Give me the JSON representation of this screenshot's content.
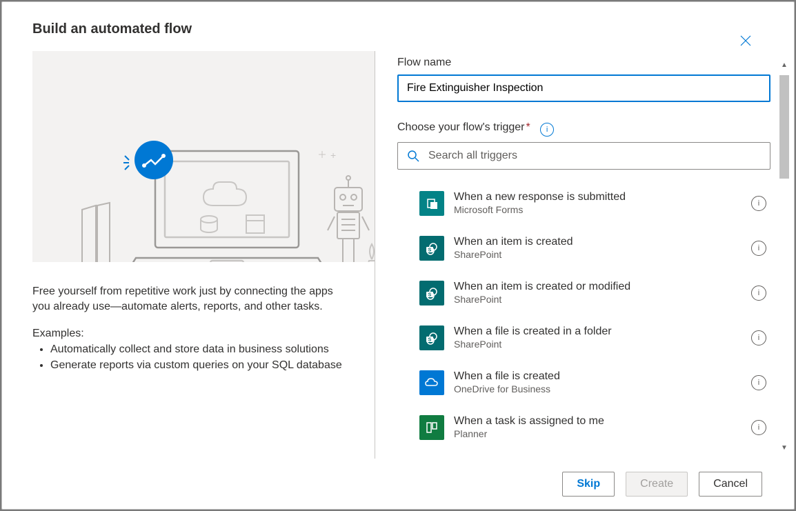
{
  "dialog": {
    "title": "Build an automated flow"
  },
  "hero": {
    "description": "Free yourself from repetitive work just by connecting the apps you already use—automate alerts, reports, and other tasks.",
    "examples_heading": "Examples:",
    "examples": [
      "Automatically collect and store data in business solutions",
      "Generate reports via custom queries on your SQL database"
    ]
  },
  "form": {
    "flow_name_label": "Flow name",
    "flow_name_value": "Fire Extinguisher Inspection",
    "trigger_label": "Choose your flow's trigger",
    "search_placeholder": "Search all triggers"
  },
  "triggers": [
    {
      "title": "When a new response is submitted",
      "connector": "Microsoft Forms",
      "icon": "forms"
    },
    {
      "title": "When an item is created",
      "connector": "SharePoint",
      "icon": "sp"
    },
    {
      "title": "When an item is created or modified",
      "connector": "SharePoint",
      "icon": "sp"
    },
    {
      "title": "When a file is created in a folder",
      "connector": "SharePoint",
      "icon": "sp"
    },
    {
      "title": "When a file is created",
      "connector": "OneDrive for Business",
      "icon": "onedrive"
    },
    {
      "title": "When a task is assigned to me",
      "connector": "Planner",
      "icon": "planner"
    }
  ],
  "buttons": {
    "skip": "Skip",
    "create": "Create",
    "cancel": "Cancel"
  },
  "icons": {
    "forms_glyph": "F",
    "sp_glyph": "s",
    "onedrive_glyph": "cloud",
    "planner_glyph": "grid"
  },
  "colors": {
    "primary": "#0078d4",
    "forms": "#038387",
    "sharepoint": "#036c70",
    "onedrive": "#0078d4",
    "planner": "#107c41"
  }
}
